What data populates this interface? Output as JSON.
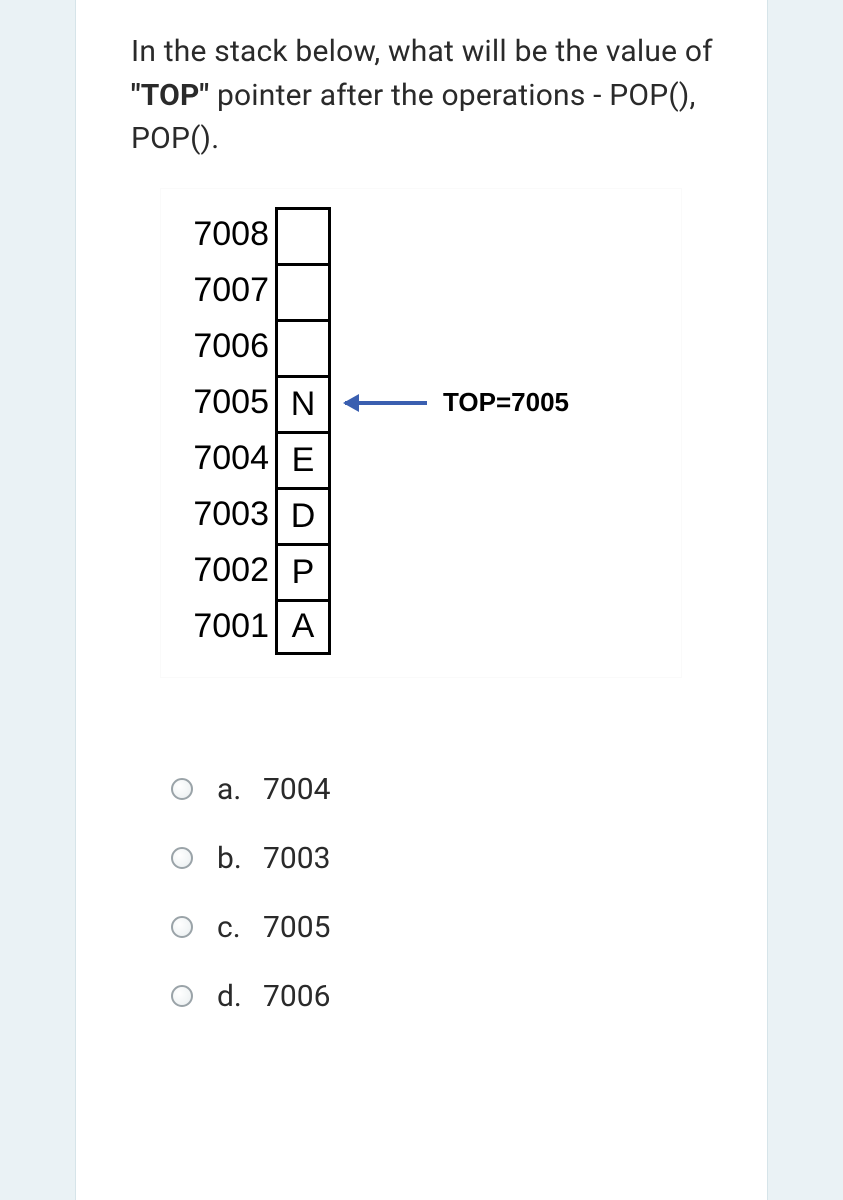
{
  "question": {
    "pre": "In the stack below, what will be the value of ",
    "bold": "\"TOP\"",
    "post": " pointer after the operations - POP(), POP()."
  },
  "stack": [
    {
      "addr": "7008",
      "val": ""
    },
    {
      "addr": "7007",
      "val": ""
    },
    {
      "addr": "7006",
      "val": ""
    },
    {
      "addr": "7005",
      "val": "N",
      "top": true
    },
    {
      "addr": "7004",
      "val": "E"
    },
    {
      "addr": "7003",
      "val": "D"
    },
    {
      "addr": "7002",
      "val": "P"
    },
    {
      "addr": "7001",
      "val": "A"
    }
  ],
  "top_label": "TOP=7005",
  "options": [
    {
      "letter": "a.",
      "text": "7004"
    },
    {
      "letter": "b.",
      "text": "7003"
    },
    {
      "letter": "c.",
      "text": "7005"
    },
    {
      "letter": "d.",
      "text": "7006"
    }
  ]
}
